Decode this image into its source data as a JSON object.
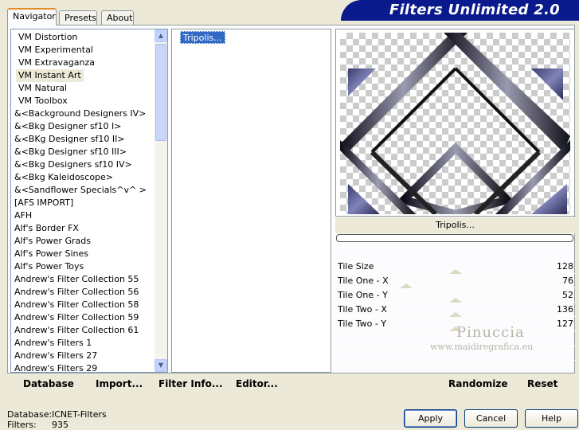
{
  "window": {
    "banner_title": "Filters Unlimited 2.0"
  },
  "tabs": [
    {
      "label": "Navigator",
      "active": true
    },
    {
      "label": "Presets",
      "active": false
    },
    {
      "label": "About",
      "active": false
    }
  ],
  "categories": [
    "VM Distortion",
    "VM Experimental",
    "VM Extravaganza",
    "VM Instant Art",
    "VM Natural",
    "VM Toolbox",
    "&<Background Designers IV>",
    "&<Bkg Designer sf10 I>",
    "&<BKg Designer sf10 II>",
    "&<Bkg Designer sf10 III>",
    "&<Bkg Designers sf10 IV>",
    "&<Bkg Kaleidoscope>",
    "&<Sandflower Specials^v^ >",
    "[AFS IMPORT]",
    "AFH",
    "Alf's Border FX",
    "Alf's Power Grads",
    "Alf's Power Sines",
    "Alf's Power Toys",
    "Andrew's Filter Collection 55",
    "Andrew's Filter Collection 56",
    "Andrew's Filter Collection 58",
    "Andrew's Filter Collection 59",
    "Andrew's Filter Collection 61",
    "Andrew's Filters 1",
    "Andrew's Filters 27",
    "Andrew's Filters 29"
  ],
  "selected_category": "VM Instant Art",
  "filters": [
    "Tripolis..."
  ],
  "selected_filter": "Tripolis...",
  "filter_name": "Tripolis...",
  "params": [
    {
      "label": "Tile Size",
      "value": "128"
    },
    {
      "label": "Tile One - X",
      "value": "76"
    },
    {
      "label": "Tile One - Y",
      "value": "52"
    },
    {
      "label": "Tile Two - X",
      "value": "136"
    },
    {
      "label": "Tile Two - Y",
      "value": "127"
    }
  ],
  "toolbar": {
    "database": "Database",
    "import": "Import...",
    "filter_info": "Filter Info...",
    "editor": "Editor..."
  },
  "right_toolbar": {
    "randomize": "Randomize",
    "reset": "Reset"
  },
  "buttons": {
    "apply": "Apply",
    "cancel": "Cancel",
    "help": "Help"
  },
  "status": {
    "database_label": "Database:",
    "database_value": "ICNET-Filters",
    "filters_label": "Filters:",
    "filters_value": "935"
  },
  "watermark": {
    "name": "Pinuccia",
    "url": "www.maidiregrafica.eu"
  },
  "icons": {
    "scroll_up": "scroll-up-arrow-icon",
    "scroll_down": "scroll-down-arrow-icon"
  }
}
